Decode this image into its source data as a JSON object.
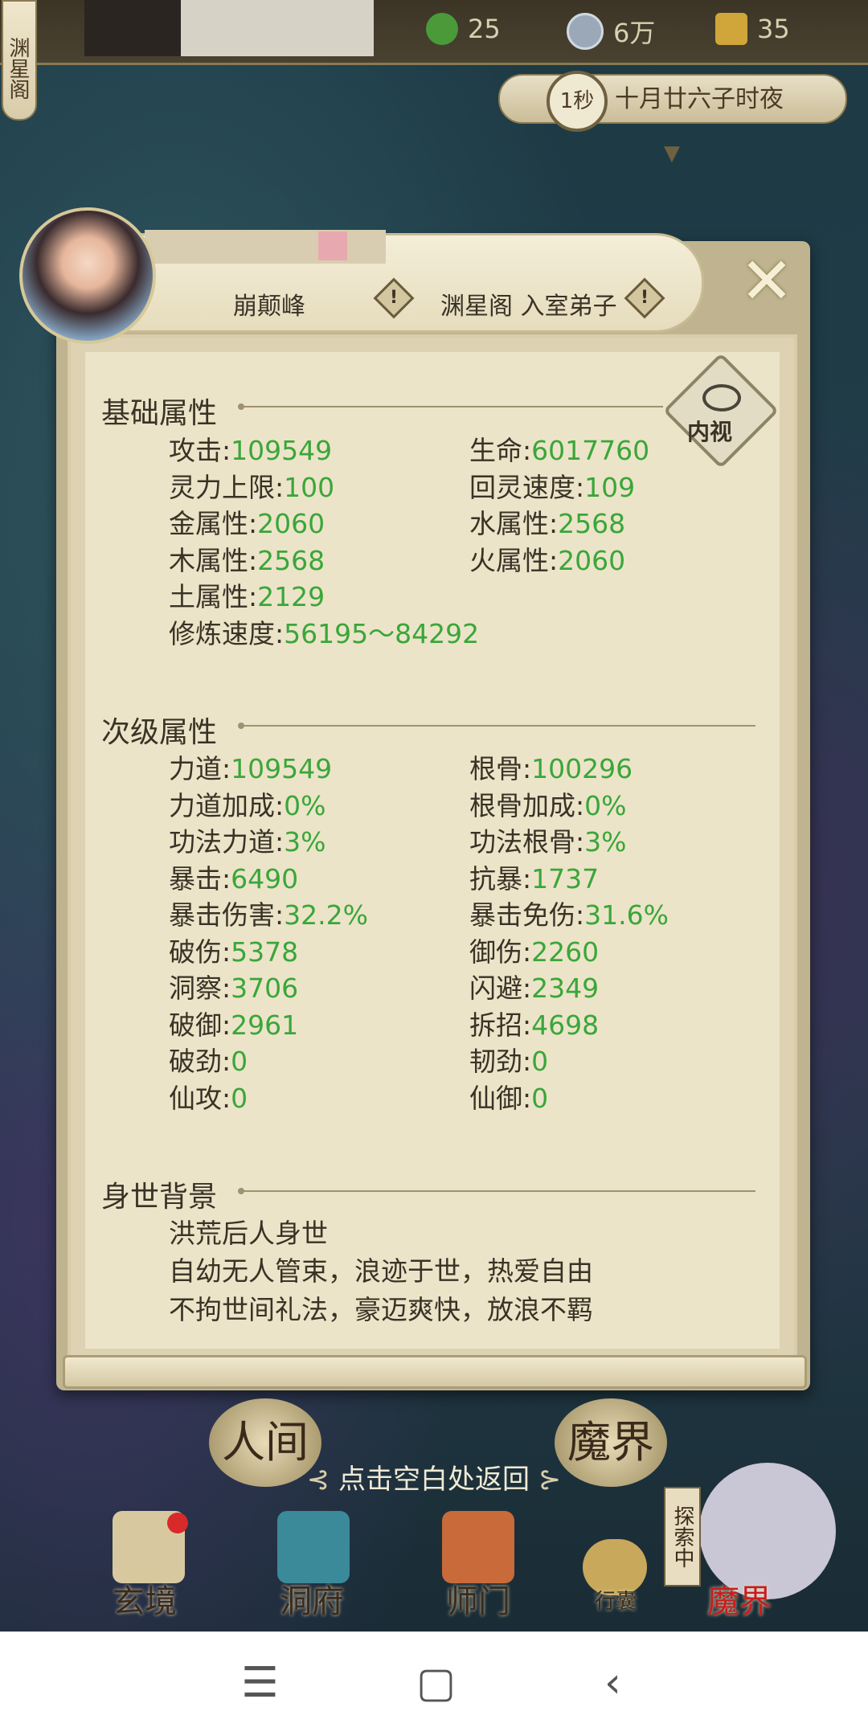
{
  "top_bar": {
    "sect_name": "渊星阁",
    "jade": "25",
    "coins": "6万",
    "spirit": "35",
    "time_dial": "1秒",
    "time_text": "十月廿六子时夜"
  },
  "header": {
    "peak": "崩颠峰",
    "rank": "渊星阁 入室弟子",
    "close_label": "✕"
  },
  "inner_view_label": "内视",
  "basic": {
    "title": "基础属性",
    "attrs": [
      {
        "label": "攻击:",
        "value": "109549"
      },
      {
        "label": "生命:",
        "value": "6017760"
      },
      {
        "label": "灵力上限:",
        "value": "100"
      },
      {
        "label": "回灵速度:",
        "value": "109"
      },
      {
        "label": "金属性:",
        "value": "2060"
      },
      {
        "label": "水属性:",
        "value": "2568"
      },
      {
        "label": "木属性:",
        "value": "2568"
      },
      {
        "label": "火属性:",
        "value": "2060"
      },
      {
        "label": "土属性:",
        "value": "2129"
      },
      {
        "label": "修炼速度:",
        "value": "56195～84292"
      }
    ]
  },
  "secondary": {
    "title": "次级属性",
    "attrs": [
      {
        "label": "力道:",
        "value": "109549"
      },
      {
        "label": "根骨:",
        "value": "100296"
      },
      {
        "label": "力道加成:",
        "value": "0%"
      },
      {
        "label": "根骨加成:",
        "value": "0%"
      },
      {
        "label": "功法力道:",
        "value": "3%"
      },
      {
        "label": "功法根骨:",
        "value": "3%"
      },
      {
        "label": "暴击:",
        "value": "6490"
      },
      {
        "label": "抗暴:",
        "value": "1737"
      },
      {
        "label": "暴击伤害:",
        "value": "32.2%"
      },
      {
        "label": "暴击免伤:",
        "value": "31.6%"
      },
      {
        "label": "破伤:",
        "value": "5378"
      },
      {
        "label": "御伤:",
        "value": "2260"
      },
      {
        "label": "洞察:",
        "value": "3706"
      },
      {
        "label": "闪避:",
        "value": "2349"
      },
      {
        "label": "破御:",
        "value": "2961"
      },
      {
        "label": "拆招:",
        "value": "4698"
      },
      {
        "label": "破劲:",
        "value": "0"
      },
      {
        "label": "韧劲:",
        "value": "0"
      },
      {
        "label": "仙攻:",
        "value": "0"
      },
      {
        "label": "仙御:",
        "value": "0"
      }
    ]
  },
  "background": {
    "title": "身世背景",
    "lines": [
      "洪荒后人身世",
      "自幼无人管束，浪迹于世，热爱自由",
      "不拘世间礼法，豪迈爽快，放浪不羁"
    ]
  },
  "return_hint": "点击空白处返回",
  "map_labels": {
    "human": "人间",
    "demon": "魔界"
  },
  "explore_tag": "探索中",
  "bottom_nav": [
    "玄境",
    "洞府",
    "师门",
    "行囊",
    "魔界"
  ],
  "android_nav": {
    "menu": "☰",
    "home": "▢",
    "back": "‹"
  },
  "colors": {
    "value_green": "#3aa63a",
    "text_brown": "#3a3226",
    "paper": "#ece4c8"
  }
}
